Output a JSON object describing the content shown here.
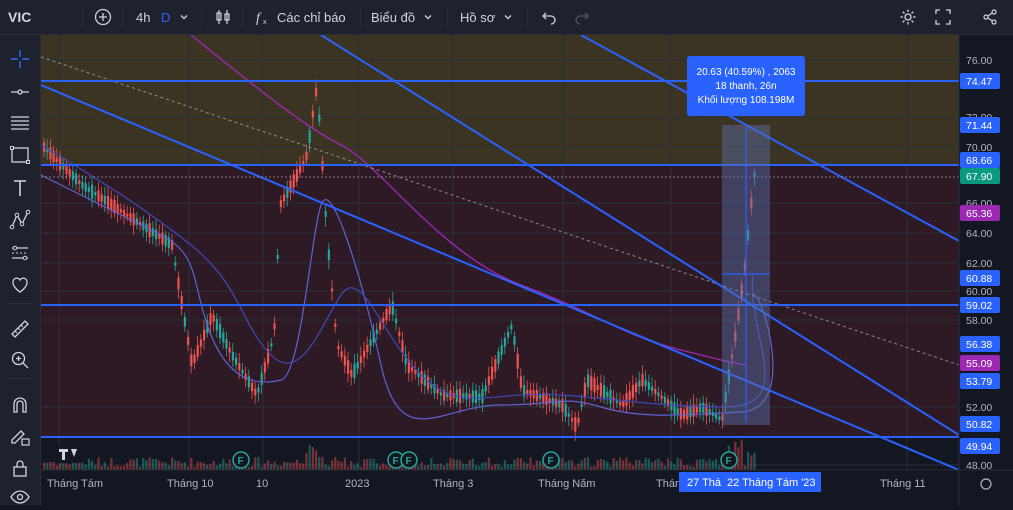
{
  "toolbar": {
    "symbol": "VIC",
    "interval": "4h",
    "d_label": "D",
    "indicators_label": "Các chỉ báo",
    "chart_type_label": "Biểu đồ",
    "profile_label": "Hồ sơ"
  },
  "sidebar_icons": [
    "crosshair-icon",
    "trendline-icon",
    "fib-icon",
    "rectangle-icon",
    "text-icon",
    "pattern-icon",
    "prediction-icon",
    "heart-icon",
    "ruler-icon",
    "zoom-icon",
    "magnet-icon",
    "lock-drawing-icon",
    "lock-icon",
    "eye-icon"
  ],
  "yaxis": {
    "ticks": [
      "76.00",
      "72.00",
      "70.00",
      "66.00",
      "64.00",
      "62.00",
      "60.00",
      "58.00",
      "52.00",
      "48.00"
    ],
    "badges": [
      {
        "label": "74.47",
        "color": "#2962ff"
      },
      {
        "label": "71.44",
        "color": "#2962ff"
      },
      {
        "label": "68.66",
        "color": "#2962ff"
      },
      {
        "label": "67.90",
        "color": "#089981"
      },
      {
        "label": "65.36",
        "color": "#9c27b0"
      },
      {
        "label": "60.88",
        "color": "#2962ff"
      },
      {
        "label": "59.02",
        "color": "#2962ff"
      },
      {
        "label": "56.38",
        "color": "#2962ff"
      },
      {
        "label": "55.09",
        "color": "#9c27b0"
      },
      {
        "label": "53.79",
        "color": "#2962ff"
      },
      {
        "label": "50.82",
        "color": "#2962ff"
      },
      {
        "label": "49.94",
        "color": "#2962ff"
      }
    ]
  },
  "xaxis": {
    "ticks": [
      "Tháng Tám",
      "Tháng 10",
      "10",
      "2023",
      "Tháng 3",
      "Tháng Năm",
      "Thán",
      "Tháng 11"
    ],
    "range_start": "27 Thá",
    "range_end": "22 Tháng Tám '23"
  },
  "measure": {
    "line1": "20.63 (40.59%) , 2063",
    "line2": "18 thanh, 26n",
    "line3": "Khối lượng 108.198M"
  },
  "events": [
    "F",
    "F",
    "F",
    "F",
    "F"
  ],
  "colors": {
    "up": "#26a69a",
    "down": "#ef5350",
    "line": "#2962ff",
    "ma": "#9c27b0"
  }
}
